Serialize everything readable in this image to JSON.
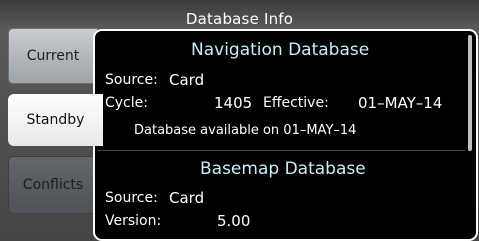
{
  "title": "Database Info",
  "tabs": {
    "current": "Current",
    "standby": "Standby",
    "conflicts": "Conflicts"
  },
  "navigation": {
    "heading": "Navigation Database",
    "source_label": "Source:",
    "source_value": "Card",
    "cycle_label": "Cycle:",
    "cycle_value": "1405",
    "effective_label": "Effective:",
    "effective_value": "01–MAY–14",
    "available_text": "Database available on 01–MAY–14"
  },
  "basemap": {
    "heading": "Basemap Database",
    "source_label": "Source:",
    "source_value": "Card",
    "version_label": "Version:",
    "version_value": "5.00"
  }
}
